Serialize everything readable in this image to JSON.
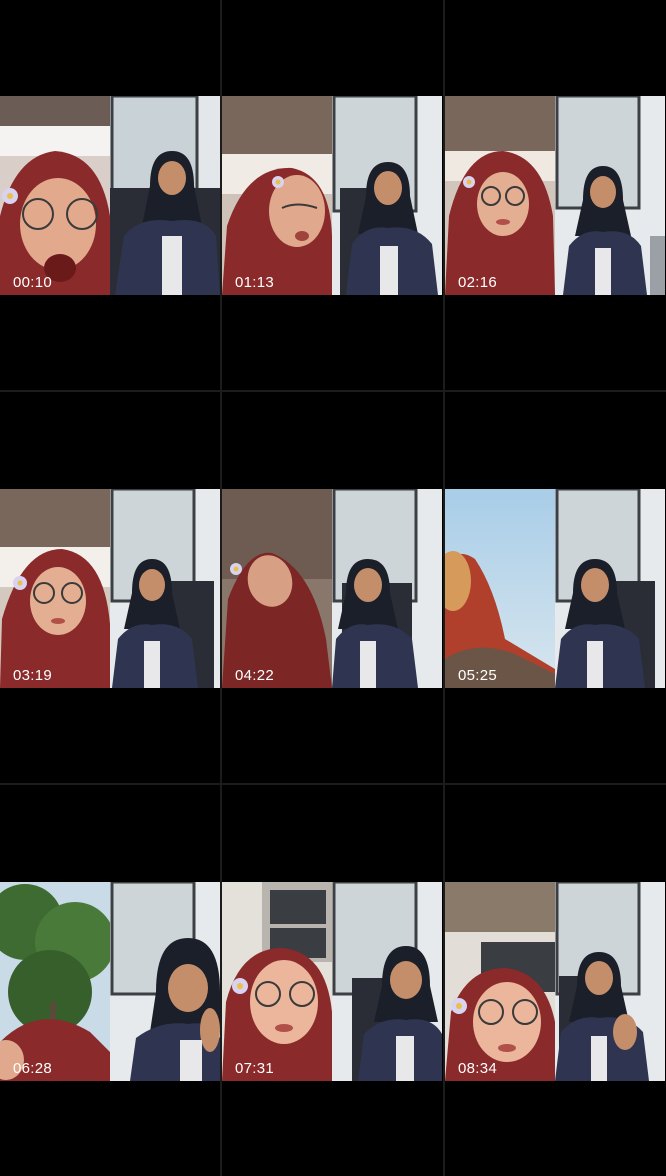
{
  "thumbnails": [
    {
      "timestamp": "00:10",
      "scene": "car"
    },
    {
      "timestamp": "01:13",
      "scene": "car"
    },
    {
      "timestamp": "02:16",
      "scene": "car"
    },
    {
      "timestamp": "03:19",
      "scene": "car"
    },
    {
      "timestamp": "04:22",
      "scene": "car"
    },
    {
      "timestamp": "05:25",
      "scene": "sky"
    },
    {
      "timestamp": "06:28",
      "scene": "trees"
    },
    {
      "timestamp": "07:31",
      "scene": "building"
    },
    {
      "timestamp": "08:34",
      "scene": "building"
    }
  ],
  "colors": {
    "background": "#000000",
    "divider": "#1c1c1c",
    "timestamp_text": "#ffffff",
    "scarf_left": "#8b2a2a",
    "hijab_right": "#1b1f29",
    "jacket_right": "#2f3550"
  }
}
